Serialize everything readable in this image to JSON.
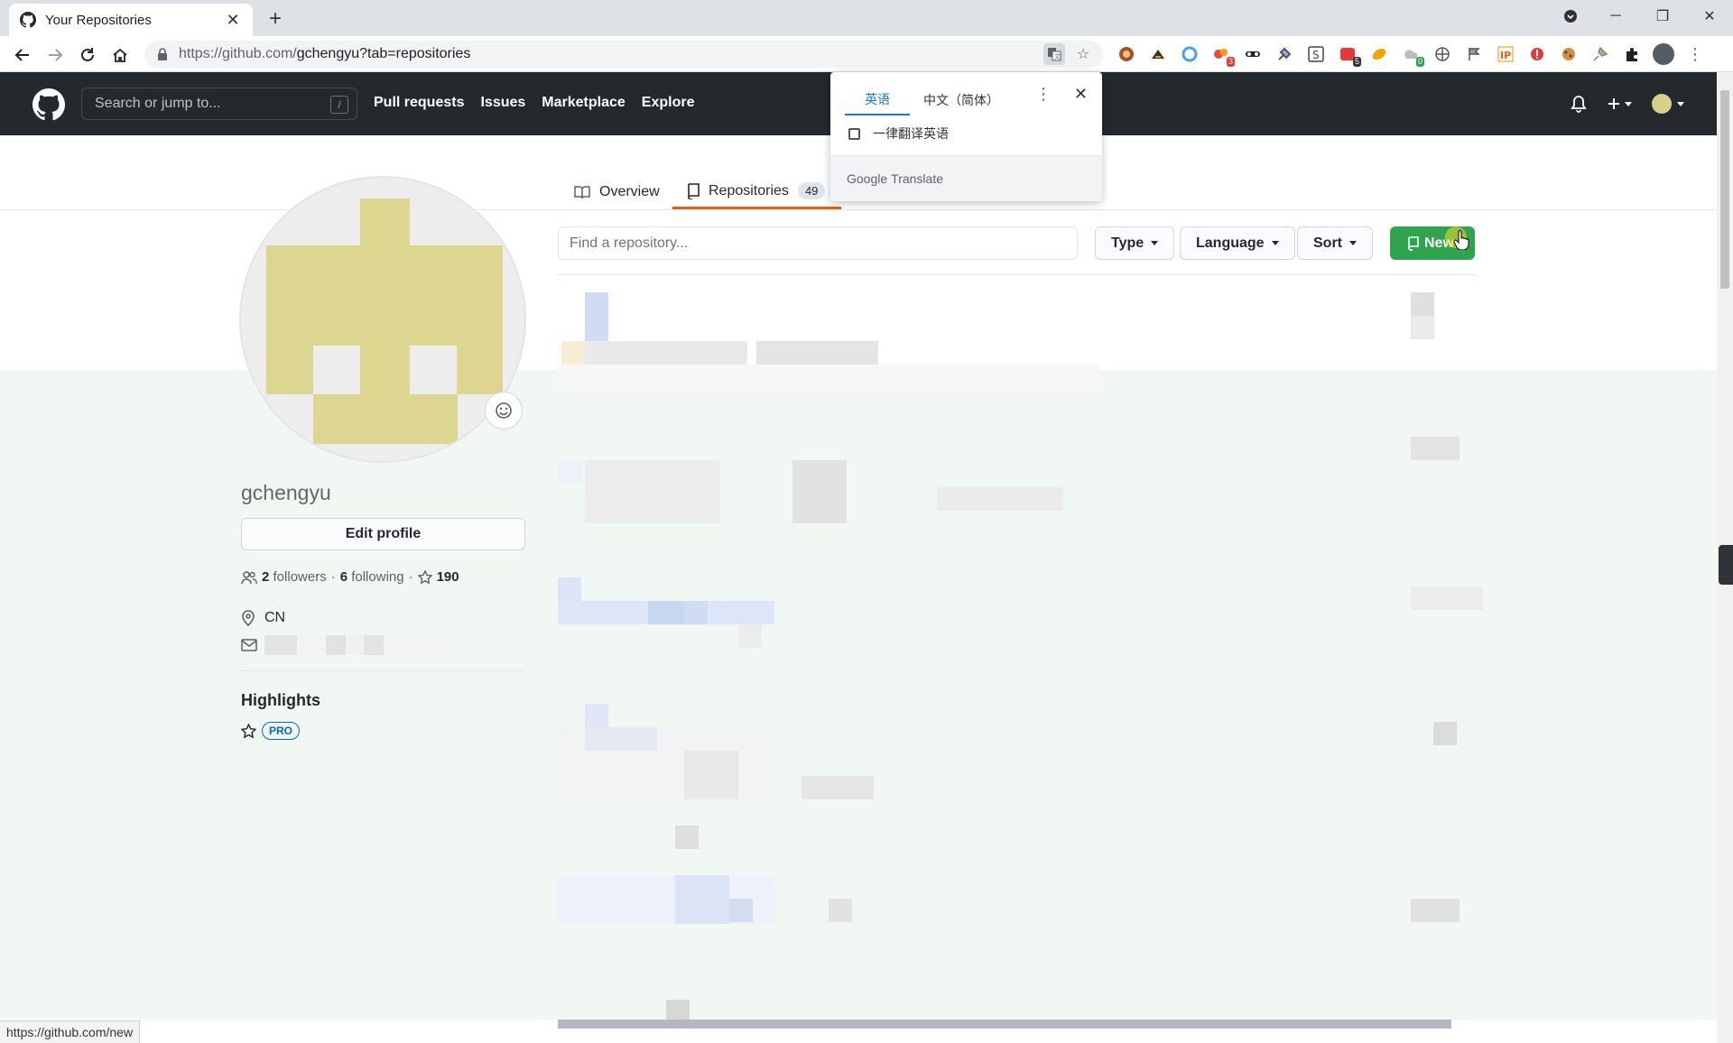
{
  "browser": {
    "tab_title": "Your Repositories",
    "url_host": "https://github.com/",
    "url_path": "gchengyu?tab=repositories",
    "status_url": "https://github.com/new",
    "extension_badges": [
      "3",
      "5",
      "0"
    ]
  },
  "header": {
    "search_placeholder": "Search or jump to...",
    "search_shortcut": "/",
    "nav": [
      "Pull requests",
      "Issues",
      "Marketplace",
      "Explore"
    ]
  },
  "translate_popup": {
    "source_lang": "英语",
    "target_lang": "中文（简体）",
    "always_translate": "一律翻译英语",
    "brand": "Google",
    "product": "Translate"
  },
  "profile_tabs": {
    "overview": "Overview",
    "repositories": "Repositories",
    "repositories_count": "49"
  },
  "profile": {
    "username": "gchengyu",
    "edit_label": "Edit profile",
    "followers_count": "2",
    "followers_label": "followers",
    "following_count": "6",
    "following_label": "following",
    "stars_count": "190",
    "location": "CN",
    "highlights_title": "Highlights",
    "pro_badge": "PRO"
  },
  "filters": {
    "find_placeholder": "Find a repository...",
    "type_label": "Type",
    "language_label": "Language",
    "sort_label": "Sort",
    "new_label": "New"
  },
  "colors": {
    "header_bg": "#24292e",
    "new_button": "#2ea44f",
    "active_tab_underline": "#e36209",
    "avatar_fill": "#ddd690"
  }
}
